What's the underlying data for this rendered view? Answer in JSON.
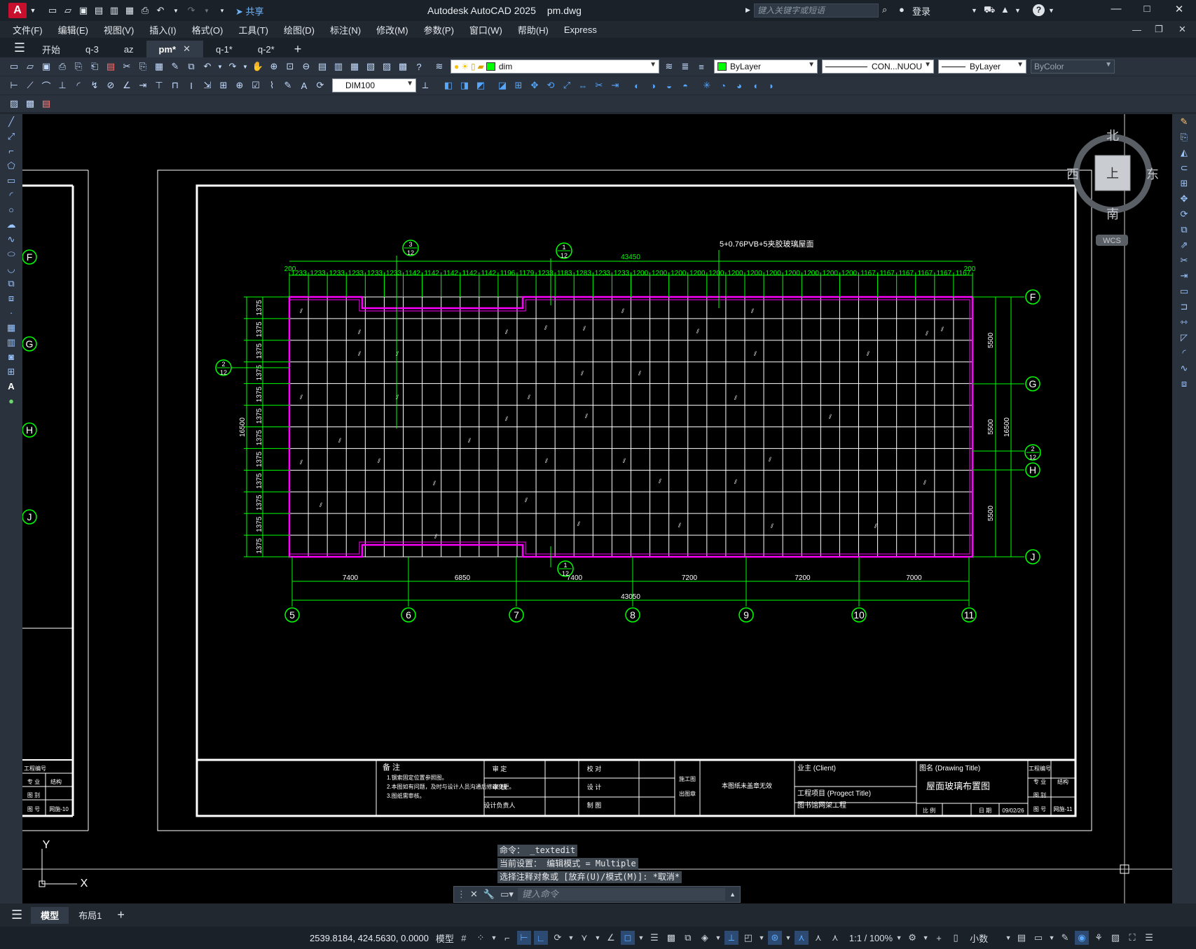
{
  "app": {
    "logo_letter": "A",
    "title": "Autodesk AutoCAD 2025",
    "filename": "pm.dwg",
    "search_placeholder": "键入关键字或短语",
    "login": "登录",
    "share": "共享"
  },
  "menu": [
    "文件(F)",
    "编辑(E)",
    "视图(V)",
    "插入(I)",
    "格式(O)",
    "工具(T)",
    "绘图(D)",
    "标注(N)",
    "修改(M)",
    "参数(P)",
    "窗口(W)",
    "帮助(H)",
    "Express"
  ],
  "file_tabs": [
    {
      "label": "开始",
      "active": false,
      "closable": false
    },
    {
      "label": "q-3",
      "active": false,
      "closable": false
    },
    {
      "label": "az",
      "active": false,
      "closable": false
    },
    {
      "label": "pm*",
      "active": true,
      "closable": true
    },
    {
      "label": "q-1*",
      "active": false,
      "closable": false
    },
    {
      "label": "q-2*",
      "active": false,
      "closable": false
    }
  ],
  "toolbar": {
    "layer": "dim",
    "color": "ByLayer",
    "linetype": "CON...NUOU",
    "lineweight": "ByLayer",
    "plotstyle": "ByColor",
    "dimstyle": "DIM100"
  },
  "viewcube": {
    "north": "北",
    "south": "南",
    "east": "东",
    "west": "西",
    "top": "上",
    "wcs": "WCS"
  },
  "colors": {
    "grid": "#ffffff",
    "dims": "#00ff00",
    "outline": "#ff00ff",
    "frame": "#ffffff",
    "background": "#000000"
  },
  "drawing": {
    "top_total": "43450",
    "top_edge_left": "200",
    "top_edge_right": "200",
    "top_spans": [
      "1233",
      "1233",
      "1233",
      "1233",
      "1233",
      "1233",
      "1142",
      "1142",
      "1142",
      "1142",
      "1142",
      "1196",
      "1179",
      "1233",
      "1183",
      "1283",
      "1233",
      "1233",
      "1200",
      "1200",
      "1200",
      "1200",
      "1200",
      "1200",
      "1200",
      "1200",
      "1200",
      "1200",
      "1200",
      "1200",
      "1167",
      "1167",
      "1167",
      "1167",
      "1167",
      "1167"
    ],
    "note": "5+0.76PVB+5夹胶玻璃屋面",
    "left_total": "16500",
    "left_spans": [
      "1375",
      "1375",
      "1375",
      "1375",
      "1375",
      "1375",
      "1375",
      "1375",
      "1375",
      "1375",
      "1375",
      "1375"
    ],
    "right_total": "16500",
    "right_spans": [
      "5500",
      "5500",
      "5500"
    ],
    "bottom_total": "43050",
    "bottom_spans": [
      "7400",
      "6850",
      "7400",
      "7200",
      "7200",
      "7000"
    ],
    "col_axes": [
      "5",
      "6",
      "7",
      "8",
      "9",
      "10",
      "11"
    ],
    "row_axes": [
      "F",
      "G",
      "H",
      "J"
    ],
    "left_sheet_axes": [
      "F",
      "G",
      "H",
      "J"
    ],
    "section_marks": [
      {
        "num": "3",
        "den": "12"
      },
      {
        "num": "1",
        "den": "12"
      },
      {
        "num": "2",
        "den": "12"
      },
      {
        "num": "2",
        "den": "12"
      },
      {
        "num": "1",
        "den": "12"
      }
    ]
  },
  "title_block": {
    "notes_title": "备 注",
    "notes": [
      "1.钢索固定位置参照图。",
      "2.本图如有问题，及时与设计人员沟通后修改变更。",
      "3.图纸需审核。"
    ],
    "approve": "审 定",
    "review": "审 核",
    "design_lead": "设计负责人",
    "check": "校 对",
    "design": "设 计",
    "draw": "制 图",
    "stamp": [
      "施工图",
      "出图章"
    ],
    "invalid": "本图纸未盖章无效",
    "client": "业主 (Client)",
    "project_label": "工程项目 (Progect Title)",
    "project": "图书馆网架工程",
    "drawing_label": "图名 (Drawing Title)",
    "drawing_title": "屋面玻璃布置图",
    "scale_label": "比 例",
    "date_label": "日 期",
    "date": "09/02/26",
    "job_no": "工程编号",
    "specialty_label": "专 业",
    "specialty": "结构",
    "sheet_label": "图 别",
    "sheet_no_label": "图 号",
    "sheet_no": "网施-11"
  },
  "left_sheet": {
    "job_no": "工程编号",
    "specialty_label": "专 业",
    "specialty": "结构",
    "sheet_label": "图 别",
    "sheet_no_label": "图 号",
    "sheet_no": "网施-10"
  },
  "command": {
    "history": [
      "命令： _textedit",
      "当前设置： 编辑模式 = Multiple",
      "选择注释对象或 [放弃(U)/模式(M)]: *取消*"
    ],
    "placeholder": "键入命令"
  },
  "layout_tabs": [
    "模型",
    "布局1"
  ],
  "status": {
    "coords": "2539.8184, 424.5630, 0.0000",
    "model": "模型",
    "scale": "1:1 / 100%",
    "units": "小数"
  }
}
